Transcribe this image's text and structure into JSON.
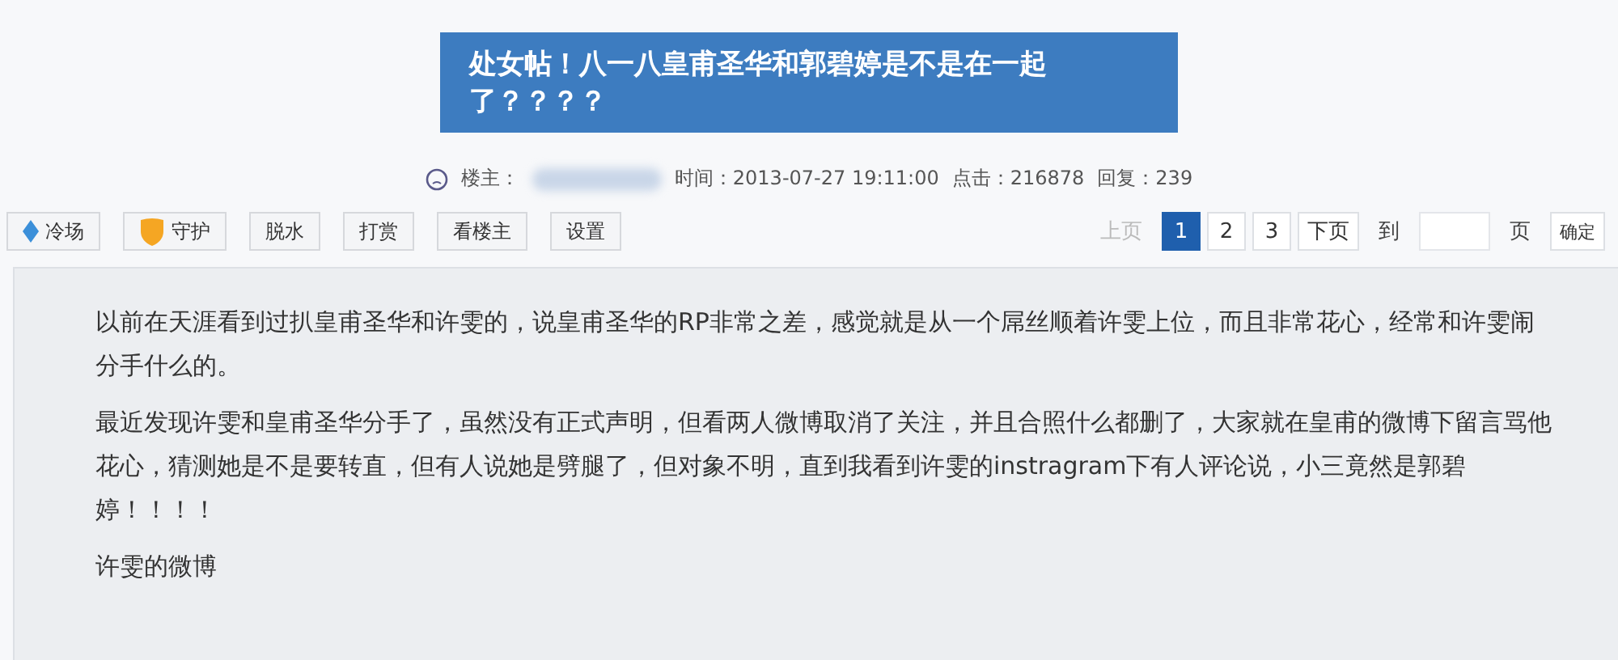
{
  "title": "处女帖！八一八皇甫圣华和郭碧婷是不是在一起了？？？？",
  "meta": {
    "author_label": "楼主：",
    "time": "时间：2013-07-27 19:11:00",
    "views": "点击：216878",
    "replies": "回复：239"
  },
  "toolbar": [
    {
      "label": "冷场",
      "kind": "gem"
    },
    {
      "label": "守护",
      "kind": "shield"
    },
    {
      "label": "脱水",
      "kind": "plain"
    },
    {
      "label": "打赏",
      "kind": "plain"
    },
    {
      "label": "看楼主",
      "kind": "plain"
    },
    {
      "label": "设置",
      "kind": "plain"
    }
  ],
  "pagination": {
    "prev": "上页",
    "pages": [
      {
        "label": "1",
        "selected": true
      },
      {
        "label": "2",
        "selected": false
      },
      {
        "label": "3",
        "selected": false
      }
    ],
    "next": "下页",
    "goto": "到",
    "unit": "页",
    "confirm": "确定"
  },
  "paragraphs": [
    "以前在天涯看到过扒皇甫圣华和许雯的，说皇甫圣华的RP非常之差，感觉就是从一个屌丝顺着许雯上位，而且非常花心，经常和许雯闹分手什么的。",
    "最近发现许雯和皇甫圣华分手了，虽然没有正式声明，但看两人微博取消了关注，并且合照什么都删了，大家就在皇甫的微博下留言骂他花心，猜测她是不是要转直，但有人说她是劈腿了，但对象不明，直到我看到许雯的instragram下有人评论说，小三竟然是郭碧婷！！！！",
    "许雯的微博"
  ]
}
